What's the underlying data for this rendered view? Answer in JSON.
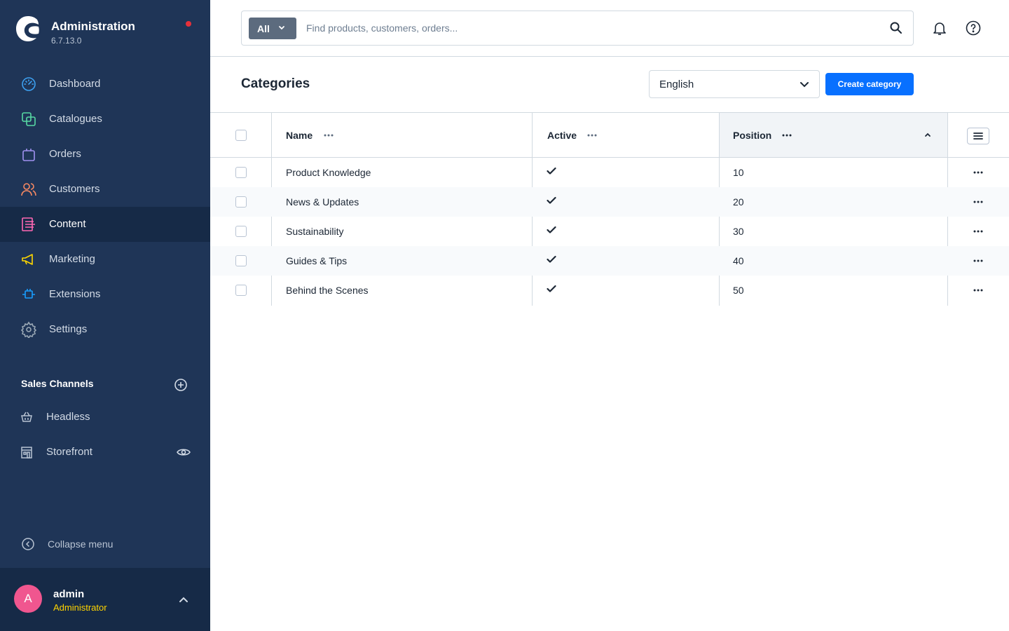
{
  "brand": {
    "title": "Administration",
    "version": "6.7.13.0"
  },
  "nav": {
    "items": [
      {
        "label": "Dashboard",
        "icon": "gauge-icon",
        "color": "#3da0f0"
      },
      {
        "label": "Catalogues",
        "icon": "catalogue-icon",
        "color": "#57d9a3"
      },
      {
        "label": "Orders",
        "icon": "shopping-bag-icon",
        "color": "#a092f0"
      },
      {
        "label": "Customers",
        "icon": "users-icon",
        "color": "#f88962"
      },
      {
        "label": "Content",
        "icon": "content-icon",
        "color": "#ff68b4",
        "active": true
      },
      {
        "label": "Marketing",
        "icon": "megaphone-icon",
        "color": "#ffd700"
      },
      {
        "label": "Extensions",
        "icon": "plug-icon",
        "color": "#189eff"
      },
      {
        "label": "Settings",
        "icon": "gear-icon",
        "color": "#9aa8b5"
      }
    ]
  },
  "sales_channels": {
    "header": "Sales Channels",
    "items": [
      {
        "label": "Headless",
        "icon": "basket-icon"
      },
      {
        "label": "Storefront",
        "icon": "storefront-icon"
      }
    ]
  },
  "collapse_label": "Collapse menu",
  "user": {
    "initial": "A",
    "name": "admin",
    "role": "Administrator"
  },
  "search": {
    "type_label": "All",
    "placeholder": "Find products, customers, orders..."
  },
  "page": {
    "title": "Categories",
    "language": "English",
    "create_label": "Create category"
  },
  "grid": {
    "columns": [
      {
        "label": "Name"
      },
      {
        "label": "Active"
      },
      {
        "label": "Position",
        "sorted": "asc"
      }
    ],
    "rows": [
      {
        "name": "Product Knowledge",
        "active": true,
        "position": "10"
      },
      {
        "name": "News & Updates",
        "active": true,
        "position": "20"
      },
      {
        "name": "Sustainability",
        "active": true,
        "position": "30"
      },
      {
        "name": "Guides & Tips",
        "active": true,
        "position": "40"
      },
      {
        "name": "Behind the Scenes",
        "active": true,
        "position": "50"
      }
    ]
  },
  "colors": {
    "sidebar": "#1f3557",
    "sidebar_active": "#162a47",
    "primary_button": "#0870ff",
    "notification_dot": "#e6303a",
    "avatar": "#f0568f",
    "user_role": "#ffd400"
  }
}
